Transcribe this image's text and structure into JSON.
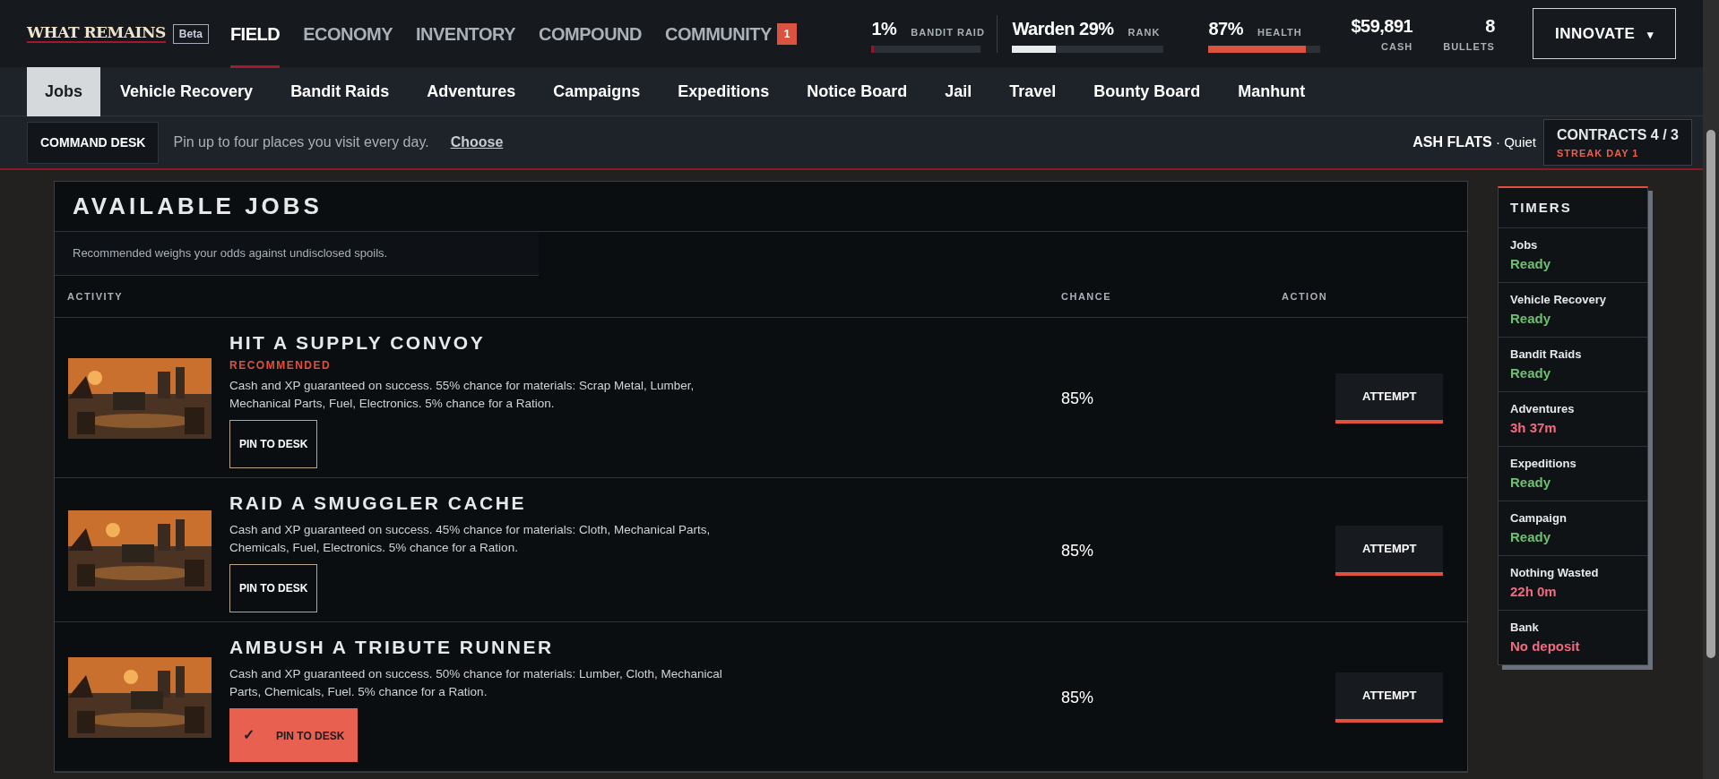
{
  "brand": {
    "logo": "WHAT REMAINS",
    "tag": "Beta"
  },
  "main_nav": [
    {
      "label": "FIELD",
      "selected": true
    },
    {
      "label": "ECONOMY",
      "selected": false
    },
    {
      "label": "INVENTORY",
      "selected": false
    },
    {
      "label": "COMPOUND",
      "selected": false
    },
    {
      "label": "COMMUNITY",
      "selected": false,
      "badge": "1"
    }
  ],
  "stats": [
    {
      "kind": "meter",
      "value": "1%",
      "label": "BANDIT RAID",
      "level": 0.01,
      "color": "#8b1a2b"
    },
    {
      "kind": "meter",
      "value": "Warden 29%",
      "label": "RANK",
      "level": 0.29,
      "color": "#e8eaec"
    },
    {
      "kind": "meter",
      "value": "87%",
      "label": "HEALTH",
      "level": 0.87,
      "color": "#d9533f"
    },
    {
      "kind": "figure",
      "value": "$59,891",
      "label": "CASH"
    },
    {
      "kind": "figure",
      "value": "8",
      "label": "BULLETS"
    }
  ],
  "menu_button": {
    "label": "INNOVATE",
    "caret": "▾"
  },
  "sub_nav": [
    {
      "label": "Jobs",
      "selected": true
    },
    {
      "label": "Vehicle Recovery",
      "selected": false
    },
    {
      "label": "Bandit Raids",
      "selected": false
    },
    {
      "label": "Adventures",
      "selected": false
    },
    {
      "label": "Campaigns",
      "selected": false
    },
    {
      "label": "Expeditions",
      "selected": false
    },
    {
      "label": "Notice Board",
      "selected": false
    },
    {
      "label": "Jail",
      "selected": false
    },
    {
      "label": "Travel",
      "selected": false
    },
    {
      "label": "Bounty Board",
      "selected": false
    },
    {
      "label": "Manhunt",
      "selected": false
    }
  ],
  "command_desk": {
    "label": "COMMAND DESK",
    "hint": "Pin up to four places you visit every day.",
    "link": "Choose"
  },
  "location": {
    "name": "ASH FLATS",
    "separator": "·",
    "status": "Quiet"
  },
  "contracts": {
    "title": "CONTRACTS 4 / 3",
    "streak": "STREAK DAY 1"
  },
  "jobs_panel": {
    "title": "AVAILABLE JOBS",
    "note": "Recommended weighs your odds against undisclosed spoils.",
    "columns": [
      "ACTIVITY",
      "CHANCE",
      "ACTION"
    ],
    "rows": [
      {
        "title": "HIT A SUPPLY CONVOY",
        "tag": "RECOMMENDED",
        "description": "Cash and XP guaranteed on success. 55% chance for materials: Scrap Metal, Lumber, Mechanical Parts, Fuel, Electronics. 5% chance for a Ration.",
        "pin": {
          "label": "PIN TO DESK",
          "checked": false
        },
        "chance": "85%",
        "action": "ATTEMPT"
      },
      {
        "title": "RAID A SMUGGLER CACHE",
        "description": "Cash and XP guaranteed on success. 45% chance for materials: Cloth, Mechanical Parts, Chemicals, Fuel, Electronics. 5% chance for a Ration.",
        "pin": {
          "label": "PIN TO DESK",
          "checked": false
        },
        "chance": "85%",
        "action": "ATTEMPT"
      },
      {
        "title": "AMBUSH A TRIBUTE RUNNER",
        "description": "Cash and XP guaranteed on success. 50% chance for materials: Lumber, Cloth, Mechanical Parts, Chemicals, Fuel. 5% chance for a Ration.",
        "pin": {
          "label": "PIN TO DESK",
          "checked": true,
          "tick": "✓"
        },
        "chance": "85%",
        "action": "ATTEMPT"
      }
    ]
  },
  "timers": {
    "title": "TIMERS",
    "items": [
      {
        "label": "Jobs",
        "value": "Ready",
        "ready": true
      },
      {
        "label": "Vehicle Recovery",
        "value": "Ready",
        "ready": true
      },
      {
        "label": "Bandit Raids",
        "value": "Ready",
        "ready": true
      },
      {
        "label": "Adventures",
        "value": "3h 37m",
        "ready": false
      },
      {
        "label": "Expeditions",
        "value": "Ready",
        "ready": true
      },
      {
        "label": "Campaign",
        "value": "Ready",
        "ready": true
      },
      {
        "label": "Nothing Wasted",
        "value": "22h 0m",
        "ready": false
      },
      {
        "label": "Bank",
        "value": "No deposit",
        "ready": false
      }
    ]
  }
}
